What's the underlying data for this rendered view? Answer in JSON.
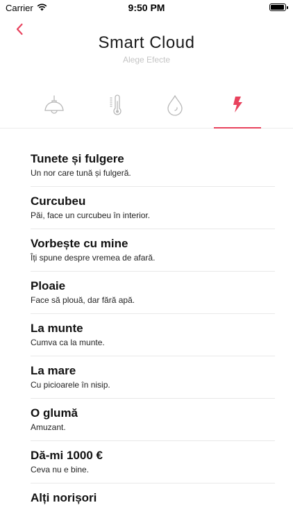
{
  "status_bar": {
    "carrier": "Carrier",
    "time": "9:50 PM",
    "battery_level": 0.95
  },
  "header": {
    "title": "Smart Cloud",
    "subtitle": "Alege Efecte",
    "back_icon": "chevron-left-icon"
  },
  "colors": {
    "accent": "#e8425d",
    "tab_icon_inactive": "#b8b8b8",
    "divider": "#e8e8e8"
  },
  "tabs": [
    {
      "icon": "lamp-icon",
      "active": false
    },
    {
      "icon": "thermometer-icon",
      "active": false
    },
    {
      "icon": "water-drop-icon",
      "active": false
    },
    {
      "icon": "lightning-bolt-icon",
      "active": true
    }
  ],
  "effects": [
    {
      "title": "Tunete și fulgere",
      "description": "Un nor care tună și fulgeră."
    },
    {
      "title": "Curcubeu",
      "description": "Păi, face un curcubeu în interior."
    },
    {
      "title": "Vorbește cu mine",
      "description": "Îți spune despre vremea de afară."
    },
    {
      "title": "Ploaie",
      "description": "Face să plouă, dar fără apă."
    },
    {
      "title": "La munte",
      "description": "Cumva ca la munte."
    },
    {
      "title": "La mare",
      "description": "Cu picioarele în nisip."
    },
    {
      "title": "O glumă",
      "description": "Amuzant."
    },
    {
      "title": "Dă-mi 1000 €",
      "description": "Ceva nu e bine."
    },
    {
      "title": "Alți norișori",
      "description": ""
    }
  ]
}
